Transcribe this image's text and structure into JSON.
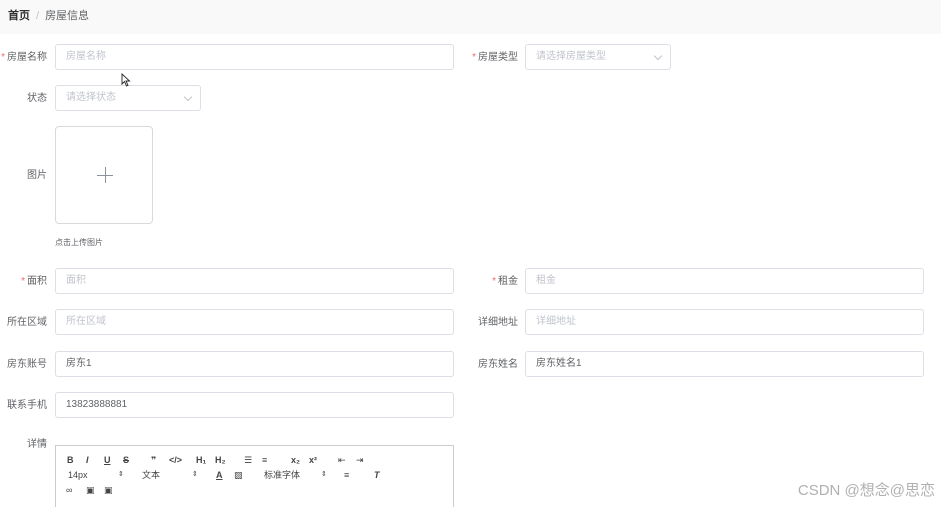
{
  "breadcrumb": {
    "home": "首页",
    "separator": "/",
    "current": "房屋信息"
  },
  "form": {
    "house_name": {
      "label": "房屋名称",
      "required": true,
      "placeholder": "房屋名称"
    },
    "house_type": {
      "label": "房屋类型",
      "required": true,
      "placeholder": "请选择房屋类型"
    },
    "status": {
      "label": "状态",
      "placeholder": "请选择状态"
    },
    "image": {
      "label": "图片",
      "hint": "点击上传图片"
    },
    "area": {
      "label": "面积",
      "required": true,
      "placeholder": "面积"
    },
    "rent": {
      "label": "租金",
      "required": true,
      "placeholder": "租金"
    },
    "region": {
      "label": "所在区域",
      "placeholder": "所在区域"
    },
    "address": {
      "label": "详细地址",
      "placeholder": "详细地址"
    },
    "landlord_account": {
      "label": "房东账号",
      "value": "房东1"
    },
    "landlord_name": {
      "label": "房东姓名",
      "value": "房东姓名1"
    },
    "phone": {
      "label": "联系手机",
      "value": "13823888881"
    },
    "details": {
      "label": "详情"
    }
  },
  "editor_toolbar": {
    "bold": "B",
    "italic": "I",
    "underline": "U",
    "strike": "S",
    "quote": "❞",
    "code": "</>",
    "h1": "H₁",
    "h2": "H₂",
    "sub": "x₂",
    "sup": "x²",
    "size": "14px",
    "header": "文本",
    "font": "标准字体"
  },
  "watermark": "CSDN @想念@思恋"
}
